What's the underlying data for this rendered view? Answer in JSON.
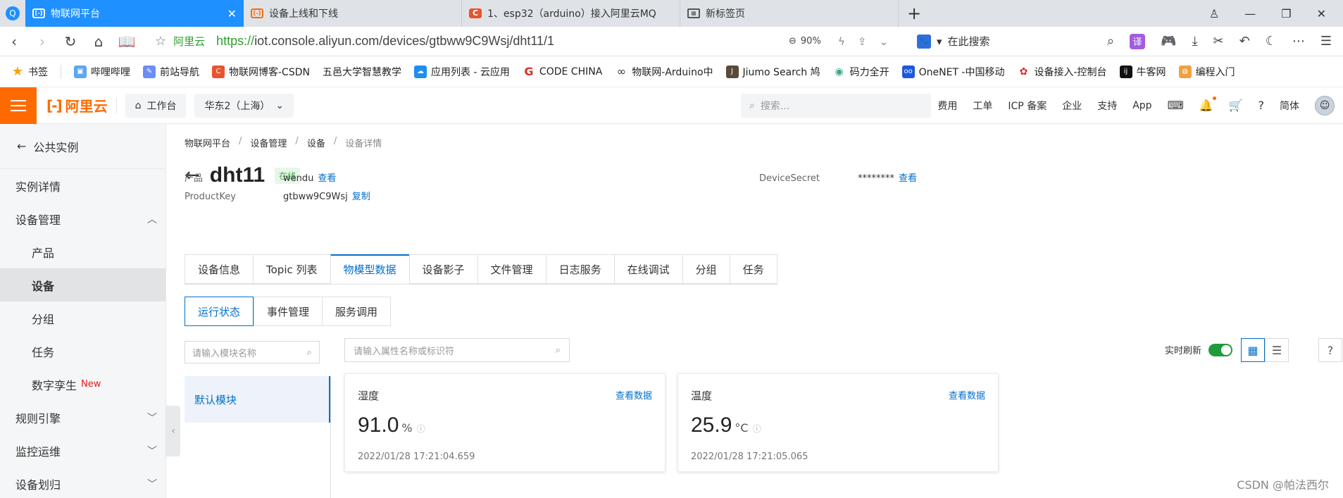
{
  "browser": {
    "tabs": [
      {
        "title": "物联网平台",
        "active": true
      },
      {
        "title": "设备上线和下线",
        "active": false
      },
      {
        "title": "1、esp32（arduino）接入阿里云MQ",
        "active": false
      },
      {
        "title": "新标签页",
        "active": false
      }
    ],
    "site_name": "阿里云",
    "url_scheme": "https://",
    "url_rest": "iot.console.aliyun.com/devices/gtbww9C9Wsj/dht11/1",
    "zoom": "90%",
    "search_placeholder": "在此搜索",
    "translate_label": "译",
    "bookmarks": [
      {
        "label": "书签"
      },
      {
        "label": "哔哩哔哩"
      },
      {
        "label": "前站导航"
      },
      {
        "label": "物联网博客-CSDN"
      },
      {
        "label": "五邑大学智慧教学"
      },
      {
        "label": "应用列表 - 云应用"
      },
      {
        "label": "CODE CHINA"
      },
      {
        "label": "物联网-Arduino中"
      },
      {
        "label": "Jiumo Search 鸠"
      },
      {
        "label": "码力全开"
      },
      {
        "label": "OneNET -中国移动"
      },
      {
        "label": "设备接入-控制台"
      },
      {
        "label": "牛客网"
      },
      {
        "label": "编程入门"
      }
    ]
  },
  "topnav": {
    "brand": "阿里云",
    "workbench": "工作台",
    "region": "华东2（上海）",
    "search_placeholder": "搜索...",
    "links": [
      "费用",
      "工单",
      "ICP 备案",
      "企业",
      "支持",
      "App"
    ],
    "lang": "简体"
  },
  "sidebar": {
    "back_label": "公共实例",
    "items": [
      {
        "label": "实例详情",
        "sub": false,
        "active": false,
        "chev": ""
      },
      {
        "label": "设备管理",
        "sub": false,
        "active": false,
        "chev": "up"
      },
      {
        "label": "产品",
        "sub": true,
        "active": false,
        "chev": ""
      },
      {
        "label": "设备",
        "sub": true,
        "active": true,
        "chev": ""
      },
      {
        "label": "分组",
        "sub": true,
        "active": false,
        "chev": ""
      },
      {
        "label": "任务",
        "sub": true,
        "active": false,
        "chev": ""
      },
      {
        "label": "数字孪生",
        "sub": true,
        "active": false,
        "chev": "",
        "badge": "New"
      },
      {
        "label": "规则引擎",
        "sub": false,
        "active": false,
        "chev": "down"
      },
      {
        "label": "监控运维",
        "sub": false,
        "active": false,
        "chev": "down"
      },
      {
        "label": "设备划归",
        "sub": false,
        "active": false,
        "chev": "down"
      }
    ]
  },
  "main": {
    "breadcrumb": [
      "物联网平台",
      "设备管理",
      "设备",
      "设备详情"
    ],
    "device_name": "dht11",
    "status": "在线",
    "meta": {
      "product_key_label": "产品",
      "product_value": "wendu",
      "product_link": "查看",
      "productkey_label": "ProductKey",
      "productkey_value": "gtbww9C9Wsj",
      "productkey_link": "复制",
      "secret_label": "DeviceSecret",
      "secret_value": "********",
      "secret_link": "查看"
    },
    "tabs": [
      "设备信息",
      "Topic 列表",
      "物模型数据",
      "设备影子",
      "文件管理",
      "日志服务",
      "在线调试",
      "分组",
      "任务"
    ],
    "active_tab": "物模型数据",
    "subtabs": [
      "运行状态",
      "事件管理",
      "服务调用"
    ],
    "active_subtab": "运行状态",
    "module_search_placeholder": "请输入模块名称",
    "property_search_placeholder": "请输入属性名称或标识符",
    "module": "默认模块",
    "realtime_label": "实时刷新",
    "realtime_on": true,
    "help": "?",
    "cards": [
      {
        "name": "湿度",
        "link": "查看数据",
        "value": "91.0",
        "unit": "%",
        "time": "2022/01/28 17:21:04.659"
      },
      {
        "name": "温度",
        "link": "查看数据",
        "value": "25.9",
        "unit": "°C",
        "time": "2022/01/28 17:21:05.065"
      }
    ]
  },
  "watermark": "CSDN @帕法西尔",
  "colors": {
    "accent": "#0070cc",
    "brand": "#ff6a00",
    "browser_tab": "#1e90ff",
    "online": "#3da54a"
  }
}
